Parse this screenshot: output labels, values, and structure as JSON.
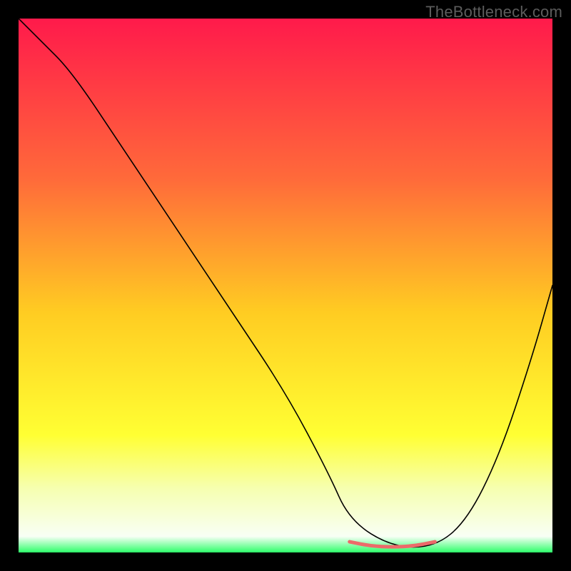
{
  "watermark": "TheBottleneck.com",
  "chart_data": {
    "type": "line",
    "title": "",
    "xlabel": "",
    "ylabel": "",
    "xlim": [
      0,
      100
    ],
    "ylim": [
      0,
      100
    ],
    "grid": false,
    "legend": false,
    "background_gradient": {
      "stops": [
        {
          "offset": 0.0,
          "color": "#ff1a4b"
        },
        {
          "offset": 0.3,
          "color": "#ff6a3a"
        },
        {
          "offset": 0.55,
          "color": "#ffcc22"
        },
        {
          "offset": 0.78,
          "color": "#ffff33"
        },
        {
          "offset": 0.88,
          "color": "#f6ffb0"
        },
        {
          "offset": 0.97,
          "color": "#f8fff5"
        },
        {
          "offset": 1.0,
          "color": "#2eff6a"
        }
      ]
    },
    "series": [
      {
        "name": "bottleneck-curve",
        "stroke": "#000000",
        "stroke_width": 1.6,
        "x": [
          0,
          4,
          10,
          20,
          30,
          40,
          50,
          58,
          62,
          70,
          78,
          84,
          90,
          96,
          100
        ],
        "y": [
          100,
          96,
          90,
          75,
          60,
          45,
          30,
          15,
          6,
          1,
          1,
          6,
          18,
          36,
          50
        ]
      },
      {
        "name": "optimal-band",
        "stroke": "#ec6a6a",
        "stroke_width": 5,
        "x": [
          62,
          66,
          70,
          74,
          78
        ],
        "y": [
          2.0,
          1.2,
          1.0,
          1.2,
          2.0
        ]
      }
    ]
  }
}
